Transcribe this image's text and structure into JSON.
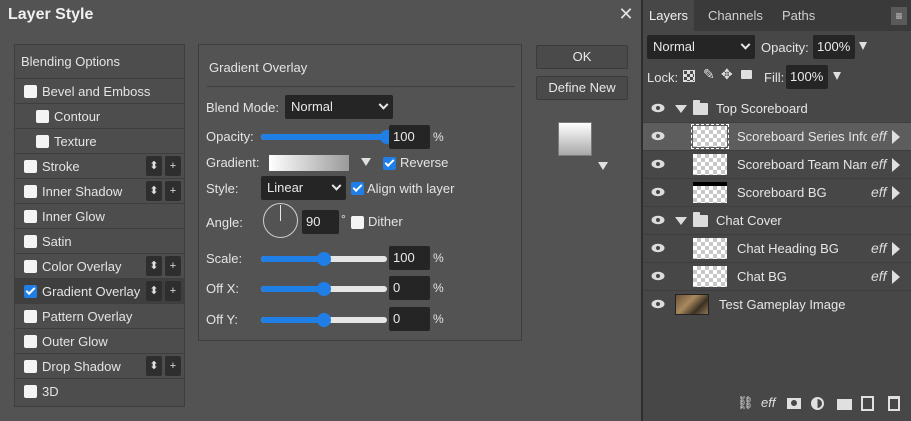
{
  "dialog": {
    "title": "Layer Style",
    "close": "✕",
    "buttons": {
      "ok": "OK",
      "define_new": "Define New"
    }
  },
  "effects": {
    "header": "Blending Options",
    "items": [
      {
        "label": "Bevel and Emboss",
        "checked": false
      },
      {
        "label": "Contour",
        "checked": false
      },
      {
        "label": "Texture",
        "checked": false
      },
      {
        "label": "Stroke",
        "checked": false
      },
      {
        "label": "Inner Shadow",
        "checked": false
      },
      {
        "label": "Inner Glow",
        "checked": false
      },
      {
        "label": "Satin",
        "checked": false
      },
      {
        "label": "Color Overlay",
        "checked": false
      },
      {
        "label": "Gradient Overlay",
        "checked": true
      },
      {
        "label": "Pattern Overlay",
        "checked": false
      },
      {
        "label": "Outer Glow",
        "checked": false
      },
      {
        "label": "Drop Shadow",
        "checked": false
      },
      {
        "label": "3D",
        "checked": false
      }
    ],
    "mini": {
      "move": "⬍",
      "add": "+"
    }
  },
  "gradient_overlay": {
    "title": "Gradient Overlay",
    "blend_mode_label": "Blend Mode:",
    "blend_mode": "Normal",
    "opacity_label": "Opacity:",
    "opacity": "100",
    "opacity_level": 1.0,
    "percent": "%",
    "gradient_label": "Gradient:",
    "reverse_label": "Reverse",
    "reverse_checked": true,
    "style_label": "Style:",
    "style": "Linear",
    "align_label": "Align with layer",
    "align_checked": true,
    "angle_label": "Angle:",
    "angle": "90",
    "degree": "°",
    "dither_label": "Dither",
    "dither_checked": false,
    "scale_label": "Scale:",
    "scale": "100",
    "scale_level": 0.5,
    "offx_label": "Off X:",
    "offx": "0",
    "offx_level": 0.5,
    "offy_label": "Off Y:",
    "offy": "0",
    "offy_level": 0.5
  },
  "layers_panel": {
    "tabs": [
      "Layers",
      "Channels",
      "Paths"
    ],
    "menu": "≡",
    "blend_mode": "Normal",
    "opacity_label": "Opacity:",
    "opacity": "100%",
    "lock_label": "Lock:",
    "fill_label": "Fill:",
    "fill": "100%",
    "eff": "eff",
    "rows": [
      {
        "name": "Top Scoreboard",
        "type": "group"
      },
      {
        "name": "Scoreboard Series Info",
        "type": "layer",
        "eff": true,
        "selected": true
      },
      {
        "name": "Scoreboard Team Names",
        "type": "layer",
        "eff": true
      },
      {
        "name": "Scoreboard BG",
        "type": "layer",
        "eff": true
      },
      {
        "name": "Chat Cover",
        "type": "group"
      },
      {
        "name": "Chat Heading BG",
        "type": "layer",
        "eff": true
      },
      {
        "name": "Chat BG",
        "type": "layer",
        "eff": true
      },
      {
        "name": "Test Gameplay Image",
        "type": "image"
      }
    ],
    "bottom_icons": [
      "link-icon",
      "eff",
      "mask-icon",
      "adjustment-icon",
      "folder-icon",
      "new-layer-icon",
      "trash-icon"
    ]
  },
  "colors": {
    "accent": "#1f7fe6",
    "dialog_bg": "#535353",
    "panel_bg": "#474747"
  }
}
